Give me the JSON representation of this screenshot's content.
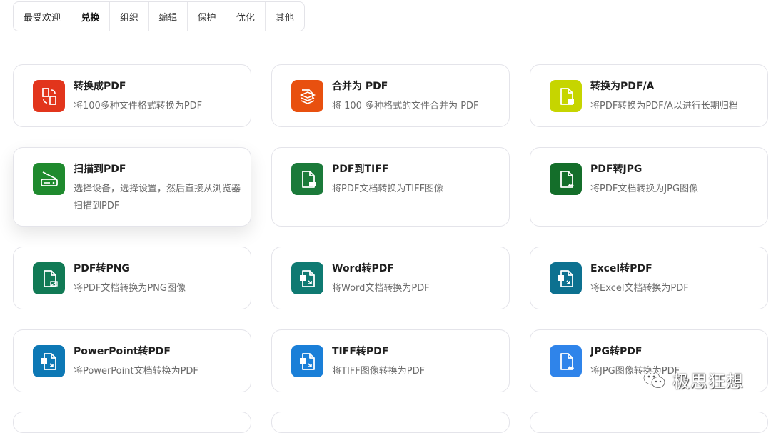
{
  "tabs": [
    {
      "label": "最受欢迎",
      "active": false
    },
    {
      "label": "兑换",
      "active": true
    },
    {
      "label": "组织",
      "active": false
    },
    {
      "label": "编辑",
      "active": false
    },
    {
      "label": "保护",
      "active": false
    },
    {
      "label": "优化",
      "active": false
    },
    {
      "label": "其他",
      "active": false
    }
  ],
  "cards": [
    {
      "title": "转换成PDF",
      "desc": "将100多种文件格式转换为PDF",
      "icon": "file-convert-icon",
      "color": "#e2351c"
    },
    {
      "title": "合并为 PDF",
      "desc": "将 100 多种格式的文件合并为 PDF",
      "icon": "stack-merge-icon",
      "color": "#e8500f"
    },
    {
      "title": "转换为PDF/A",
      "desc": "将PDF转换为PDF/A以进行长期归档",
      "icon": "pdfa-file-icon",
      "color": "#c6d500"
    },
    {
      "title": "扫描到PDF",
      "desc": "选择设备，选择设置，然后直接从浏览器扫描到PDF",
      "icon": "scanner-icon",
      "color": "#1f8a2e"
    },
    {
      "title": "PDF到TIFF",
      "desc": "将PDF文档转换为TIFF图像",
      "icon": "tiff-file-icon",
      "color": "#1b7a3a"
    },
    {
      "title": "PDF转JPG",
      "desc": "将PDF文档转换为JPG图像",
      "icon": "jpg-file-icon",
      "color": "#146e2a"
    },
    {
      "title": "PDF转PNG",
      "desc": "将PDF文档转换为PNG图像",
      "icon": "png-file-icon",
      "color": "#117a55"
    },
    {
      "title": "Word转PDF",
      "desc": "将Word文档转换为PDF",
      "icon": "word-file-icon",
      "color": "#0f7a72"
    },
    {
      "title": "Excel转PDF",
      "desc": "将Excel文档转换为PDF",
      "icon": "excel-file-icon",
      "color": "#0d7190"
    },
    {
      "title": "PowerPoint转PDF",
      "desc": "将PowerPoint文档转换为PDF",
      "icon": "powerpoint-file-icon",
      "color": "#0d78b5"
    },
    {
      "title": "TIFF转PDF",
      "desc": "将TIFF图像转换为PDF",
      "icon": "tiff-to-pdf-icon",
      "color": "#1a7fd8"
    },
    {
      "title": "JPG转PDF",
      "desc": "将JPG图像转换为PDF",
      "icon": "jpg-to-pdf-icon",
      "color": "#2f84ea"
    }
  ],
  "watermark": {
    "text": "极思狂想",
    "icon": "wechat-icon"
  }
}
